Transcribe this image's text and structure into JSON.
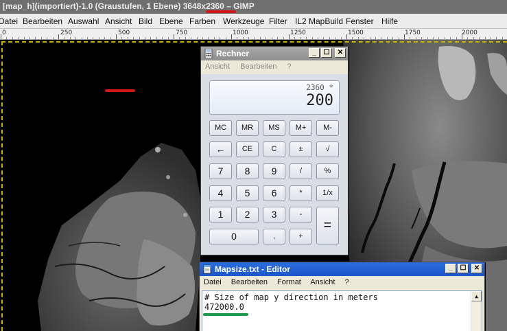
{
  "gimp": {
    "window_title": "[map_h](importiert)-1.0 (Graustufen, 1 Ebene) 3648x2360 – GIMP",
    "menu": [
      "Datei",
      "Bearbeiten",
      "Auswahl",
      "Ansicht",
      "Bild",
      "Ebene",
      "Farben",
      "Werkzeuge",
      "Filter",
      "IL2 MapBuild",
      "Fenster",
      "Hilfe"
    ],
    "ruler_labels": [
      "0",
      "250",
      "500",
      "750",
      "1000",
      "1250",
      "1500",
      "1750",
      "2000"
    ]
  },
  "calculator": {
    "title": "Rechner",
    "menu": [
      "Ansicht",
      "Bearbeiten",
      "?"
    ],
    "display_expression": "2360 *",
    "display_value": "200",
    "keys": [
      "MC",
      "MR",
      "MS",
      "M+",
      "M-",
      "←",
      "CE",
      "C",
      "±",
      "√",
      "7",
      "8",
      "9",
      "/",
      "%",
      "4",
      "5",
      "6",
      "*",
      "1/x",
      "1",
      "2",
      "3",
      "-",
      "=",
      "0",
      ",",
      "+"
    ]
  },
  "notepad": {
    "title": "Mapsize.txt - Editor",
    "menu": [
      "Datei",
      "Bearbeiten",
      "Format",
      "Ansicht",
      "?"
    ],
    "line1": "# Size of map y direction in meters",
    "line2": "472000.0"
  },
  "colors": {
    "gimp_title_bg": "#6f6f6f",
    "highlight_red": "#d01818",
    "highlight_green": "#1e9a4a",
    "notepad_title_blue": "#2b6ee0",
    "calc_title_gray": "#9a9a9a"
  }
}
